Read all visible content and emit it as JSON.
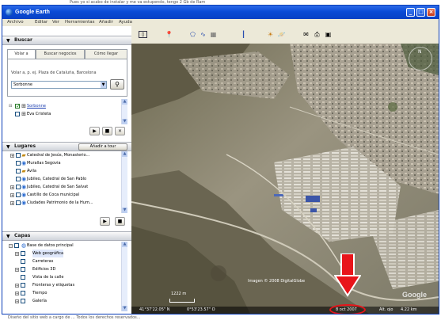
{
  "background_text": "Pues yo si acabo de instalar y me va estupendo, tengo 2 Gb de Ram",
  "window": {
    "title": "Google Earth",
    "controls": [
      "_",
      "□",
      "×"
    ]
  },
  "menu": [
    "Archivo",
    "Editar",
    "Ver",
    "Herramientas",
    "Añadir",
    "Ayuda"
  ],
  "toolbar_icons": [
    "sidebar-toggle-icon",
    "placemark-icon",
    "polygon-icon",
    "path-icon",
    "overlay-icon",
    "ruler-icon",
    "sun-icon",
    "planets-icon",
    "email-icon",
    "print-icon",
    "maps-icon"
  ],
  "search": {
    "header": "Buscar",
    "tabs": [
      "Volar a",
      "Buscar negocios",
      "Cómo llegar"
    ],
    "hint": "Volar a, p. ej. Plaza de Cataluña, Barcelona",
    "value": "Sorbonne",
    "results": [
      {
        "label": "Sorbonne",
        "checked": true,
        "link": true
      },
      {
        "label": "Eva Cristeta",
        "checked": false,
        "link": false
      }
    ]
  },
  "places": {
    "header": "Lugares",
    "tour_button": "Añadir a tour",
    "items": [
      "Catedral de Jesús, Monasterio...",
      "Murallas Segovia",
      "Ávila",
      "Jubileo, Catedral de San Pablo",
      "Jubileo, Catedral de San Salvat",
      "Castillo de Coca municipal",
      "Ciudades Patrimonio de la Hum..."
    ]
  },
  "layers": {
    "header": "Capas",
    "items": [
      "Base de datos principal",
      "Web geográfica",
      "Carreteras",
      "Edificios 3D",
      "Vista de la calle",
      "Fronteras y etiquetas",
      "Tiempo",
      "Galería"
    ]
  },
  "map": {
    "imagery_credit": "Imagen © 2008 DigitalGlobe",
    "scale_label": "1222 m",
    "logo": "Google",
    "pointer_color": "#E8141A",
    "highlight_color": "#E8141A"
  },
  "status": {
    "lat": "41°37'22.05\" N",
    "lon": "0°53'23.57\" O",
    "date": "8 oct 2007",
    "alt_label": "Alt. ojo",
    "alt_value": "4.22 km"
  },
  "bottom_text": "Diseño del sitio web a cargo de ... Todos los derechos reservados..."
}
